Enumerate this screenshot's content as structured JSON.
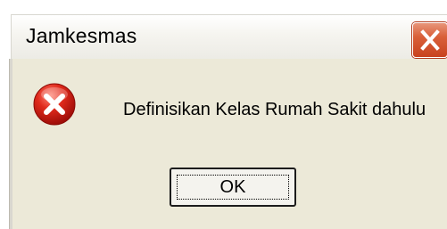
{
  "window": {
    "title": "Jamkesmas",
    "close_icon": "close-icon"
  },
  "dialog": {
    "icon": "error-icon",
    "message": "Definisikan Kelas Rumah Sakit dahulu",
    "ok_label": "OK"
  },
  "colors": {
    "close_button": "#d9603a",
    "error_icon": "#d21b1b",
    "dialog_background": "#ece9d8"
  }
}
